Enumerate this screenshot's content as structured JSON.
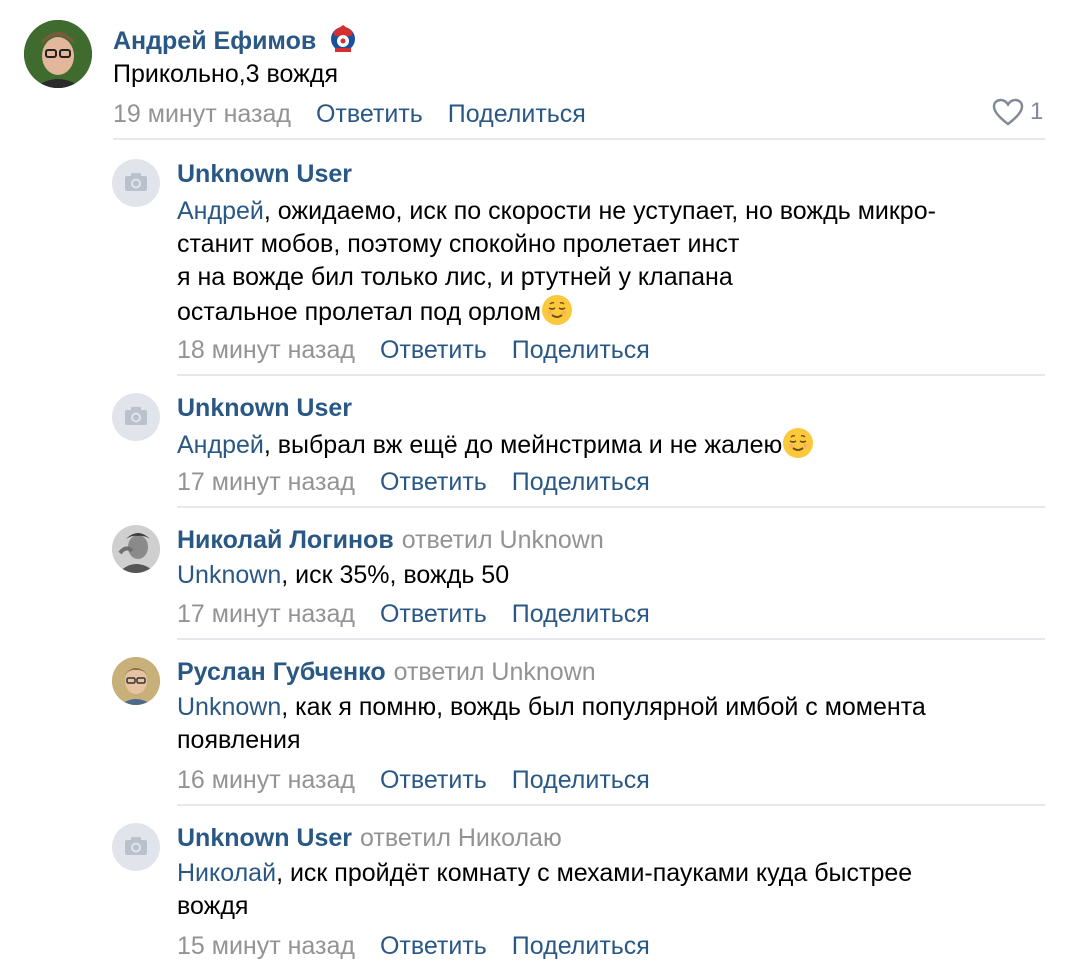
{
  "comments": [
    {
      "author": "Андрей Ефимов",
      "lines": [
        "Прикольно,3 вождя"
      ],
      "time": "19 минут назад",
      "reply": "Ответить",
      "share": "Поделиться",
      "likes": "1"
    },
    {
      "author": "Unknown User",
      "mention": "Андрей",
      "lines": [
        ", ожидаемо, иск по скорости не уступает, но вождь микро-",
        "станит мобов, поэтому спокойно пролетает инст",
        "я на вожде бил только лис, и ртутней у клапана",
        "остальное пролетал под орлом"
      ],
      "time": "18 минут назад",
      "reply": "Ответить",
      "share": "Поделиться"
    },
    {
      "author": "Unknown User",
      "mention": "Андрей",
      "lines": [
        ", выбрал вж ещё до мейнстрима и не жалею"
      ],
      "time": "17 минут назад",
      "reply": "Ответить",
      "share": "Поделиться"
    },
    {
      "author": "Николай Логинов",
      "replied_to": "ответил Unknown",
      "mention": "Unknown",
      "lines": [
        ", иск 35%, вождь 50"
      ],
      "time": "17 минут назад",
      "reply": "Ответить",
      "share": "Поделиться"
    },
    {
      "author": "Руслан Губченко",
      "replied_to": "ответил Unknown",
      "mention": "Unknown",
      "lines": [
        ", как я помню, вождь был популярной имбой с момента",
        "появления"
      ],
      "time": "16 минут назад",
      "reply": "Ответить",
      "share": "Поделиться"
    },
    {
      "author": "Unknown User",
      "replied_to": "ответил Николаю",
      "mention": "Николай",
      "lines": [
        ", иск пройдёт комнату с мехами-пауками куда быстрее",
        "вождя"
      ],
      "time": "15 минут назад",
      "reply": "Ответить",
      "share": "Поделиться"
    }
  ],
  "colors": {
    "link": "#2a5885",
    "meta": "#939393",
    "divider": "#e7e8ec",
    "placeholder_avatar": "#e1e5eb"
  }
}
